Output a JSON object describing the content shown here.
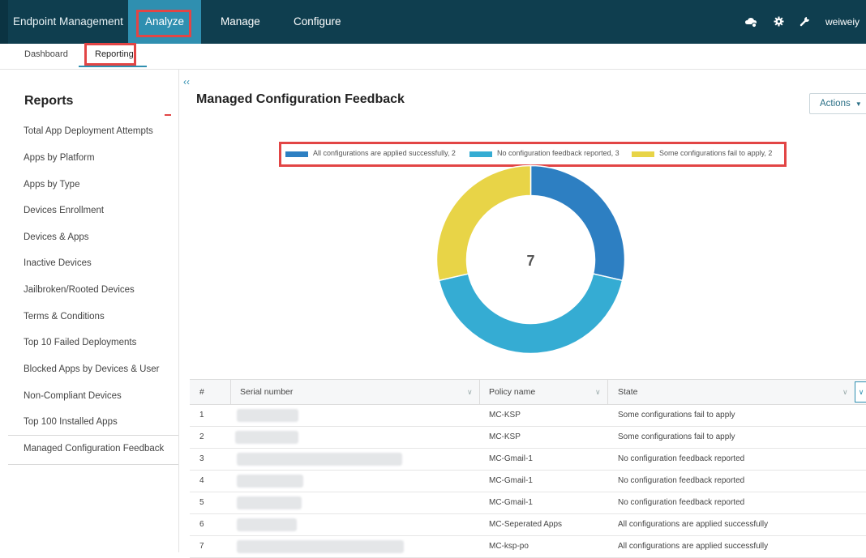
{
  "topbar": {
    "brand": "Endpoint Management",
    "nav": [
      "Analyze",
      "Manage",
      "Configure"
    ],
    "icons": [
      "cloud-gear-icon",
      "gear-icon",
      "wrench-icon"
    ],
    "user": "weiweiy"
  },
  "subnav": {
    "tabs": [
      "Dashboard",
      "Reporting"
    ]
  },
  "sidebar": {
    "title": "Reports",
    "items": [
      "Total App Deployment Attempts",
      "Apps by Platform",
      "Apps by Type",
      "Devices Enrollment",
      "Devices & Apps",
      "Inactive Devices",
      "Jailbroken/Rooted Devices",
      "Terms & Conditions",
      "Top 10 Failed Deployments",
      "Blocked Apps by Devices & User",
      "Non-Compliant Devices",
      "Top 100 Installed Apps",
      "Managed Configuration Feedback"
    ]
  },
  "main": {
    "collapse_glyph": "‹‹",
    "title": "Managed Configuration Feedback",
    "actions_label": "Actions"
  },
  "colors": {
    "success": "#2d7fc2",
    "no_feedback": "#35acd3",
    "fail": "#e8d447",
    "accent": "#2f8fb0",
    "highlight": "#e24545"
  },
  "chart_data": {
    "type": "pie",
    "center_total": "7",
    "legend": [
      "All configurations are applied successfully, 2",
      "No configuration feedback reported, 3",
      "Some configurations fail to apply, 2"
    ],
    "slices": [
      {
        "label": "All configurations are applied successfully",
        "value": 2,
        "color": "#2d7fc2"
      },
      {
        "label": "No configuration feedback reported",
        "value": 3,
        "color": "#35acd3"
      },
      {
        "label": "Some configurations fail to apply",
        "value": 2,
        "color": "#e8d447"
      }
    ]
  },
  "table": {
    "headers": [
      "#",
      "Serial number",
      "Policy name",
      "State"
    ],
    "rows": [
      {
        "num": "1",
        "policy": "MC-KSP",
        "state": "Some configurations fail to apply"
      },
      {
        "num": "2",
        "policy": "MC-KSP",
        "state": "Some configurations fail to apply"
      },
      {
        "num": "3",
        "policy": "MC-Gmail-1",
        "state": "No configuration feedback reported"
      },
      {
        "num": "4",
        "policy": "MC-Gmail-1",
        "state": "No configuration feedback reported"
      },
      {
        "num": "5",
        "policy": "MC-Gmail-1",
        "state": "No configuration feedback reported"
      },
      {
        "num": "6",
        "policy": "MC-Seperated Apps",
        "state": "All configurations are applied successfully"
      },
      {
        "num": "7",
        "policy": "MC-ksp-po",
        "state": "All configurations are applied successfully"
      }
    ]
  }
}
